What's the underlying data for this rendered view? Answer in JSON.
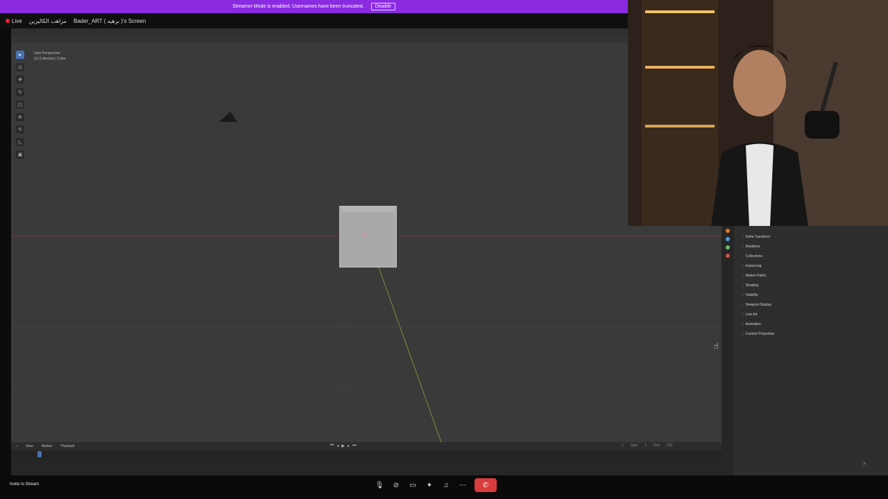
{
  "banner": {
    "text": "Streamer Mode is enabled. Usernames have been truncated.",
    "disable_label": "Disable",
    "color": "#8a2be2"
  },
  "stream": {
    "live_label": "Live",
    "server_name": "مراهب الكاليزين",
    "title": "Bader_ART ( برهيه )'s Screen"
  },
  "blender": {
    "viewport_info_line1": "User Perspective",
    "viewport_info_line2": "(1) Collection | Cube",
    "properties": [
      "Delta Transform",
      "Relations",
      "Collections",
      "Instancing",
      "Motion Paths",
      "Shading",
      "Visibility",
      "Viewport Display",
      "Line Art",
      "Animation",
      "Custom Properties"
    ],
    "timeline": {
      "view": "View",
      "marker": "Marker",
      "playback": "Playback",
      "current_frame": "1",
      "start_label": "Start",
      "start": "1",
      "end_label": "End",
      "end": "250"
    }
  },
  "bottom": {
    "invite_label": "Invite to Stream"
  },
  "colors": {
    "viewport_bg": "#3a3a3a",
    "leave_button": "#d83c3e",
    "accent": "#4772b3"
  }
}
